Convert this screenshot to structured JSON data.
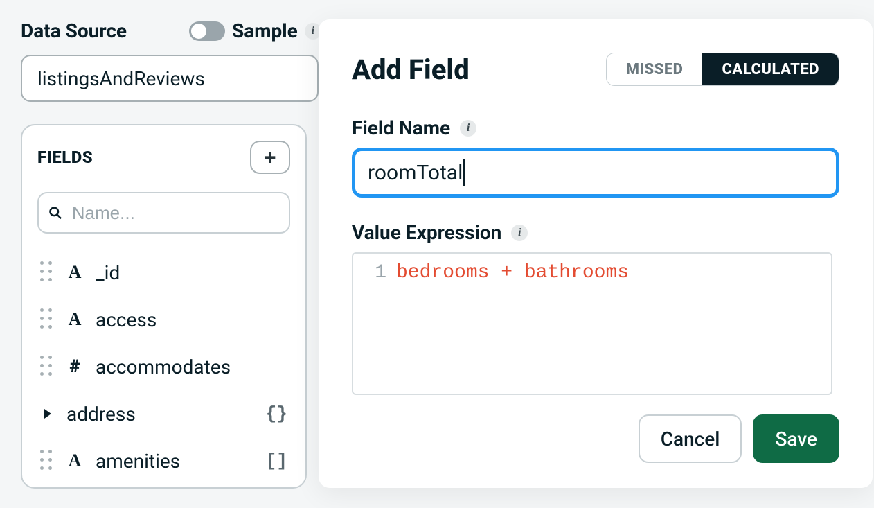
{
  "header": {
    "data_source_label": "Data Source",
    "sample_label": "Sample",
    "data_source_value": "listingsAndReviews"
  },
  "fields_panel": {
    "title": "FIELDS",
    "search_placeholder": "Name...",
    "items": [
      {
        "type_icon": "A",
        "name": "_id",
        "expandable": false,
        "badge": ""
      },
      {
        "type_icon": "A",
        "name": "access",
        "expandable": false,
        "badge": ""
      },
      {
        "type_icon": "#",
        "name": "accommodates",
        "expandable": false,
        "badge": ""
      },
      {
        "type_icon": "",
        "name": "address",
        "expandable": true,
        "badge": "{}"
      },
      {
        "type_icon": "A",
        "name": "amenities",
        "expandable": false,
        "badge": "[]"
      }
    ]
  },
  "modal": {
    "title": "Add Field",
    "tabs": {
      "missed": "MISSED",
      "calculated": "CALCULATED",
      "active": "calculated"
    },
    "field_name_label": "Field Name",
    "field_name_value": "roomTotal",
    "expression_label": "Value Expression",
    "expression_line_number": "1",
    "expression_tokens": [
      "bedrooms",
      " + ",
      "bathrooms"
    ],
    "buttons": {
      "cancel": "Cancel",
      "save": "Save"
    }
  },
  "icons": {
    "info": "i",
    "plus": "+",
    "search": "search-icon"
  }
}
